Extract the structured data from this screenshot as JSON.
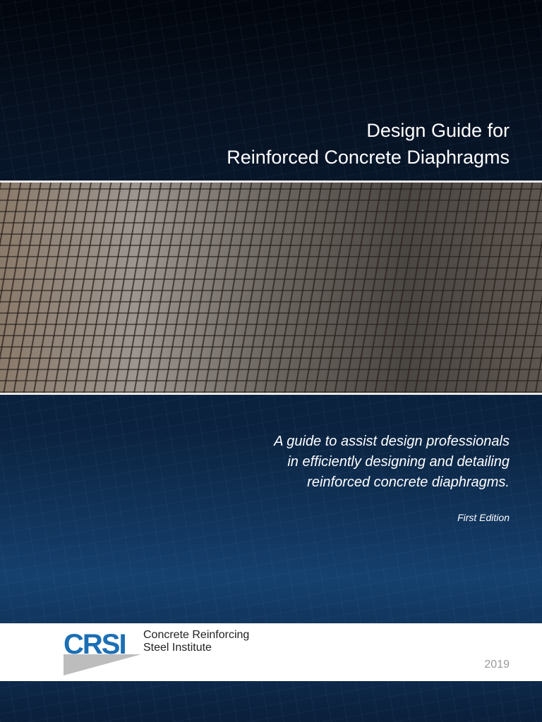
{
  "title_line1": "Design Guide for",
  "title_line2": "Reinforced Concrete Diaphragms",
  "subtitle": [
    "A guide to assist design professionals",
    "in efficiently designing and detailing",
    "reinforced concrete diaphragms."
  ],
  "edition": "First Edition",
  "publisher": {
    "logo": "CRSI",
    "name_line1": "Concrete Reinforcing",
    "name_line2": "Steel Institute"
  },
  "year": "2019"
}
